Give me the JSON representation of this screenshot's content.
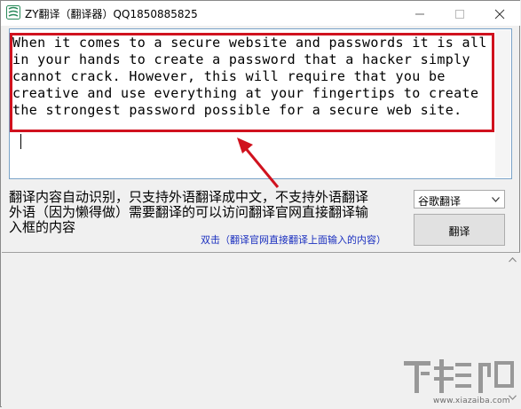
{
  "window": {
    "title": "ZY翻译（翻译器）QQ1850885825",
    "controls": [
      "minimize-icon",
      "maximize-icon",
      "close-icon"
    ]
  },
  "source": {
    "text": "When it comes to a secure website and passwords it is all in your hands to create a password that a hacker simply cannot crack. However, this will require that you be creative and use everything at your fingertips to create the strongest password possible for a secure web site."
  },
  "info": {
    "lines": [
      "翻译内容自动识别，只支持外语翻译成中文，不支持外语翻译",
      "外语（因为懒得做）需要翻译的可以访问翻译官网直接翻译输",
      "入框的内容"
    ],
    "link": "双击（翻译官网直接翻译上面输入的内容）"
  },
  "engine": {
    "selected": "谷歌翻译"
  },
  "translate_button": {
    "label": "翻译"
  },
  "output": {
    "text": ""
  },
  "watermark": {
    "brand": "下载吧",
    "url": "www.xiazaiba.com"
  },
  "colors": {
    "highlight": "#d0121e",
    "link": "#1a2fbf",
    "arrow": "#d0121e"
  }
}
